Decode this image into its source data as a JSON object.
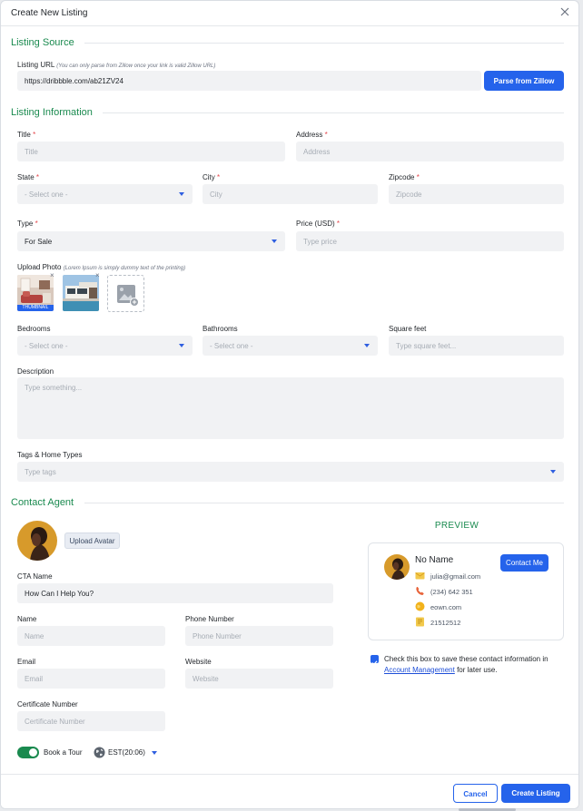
{
  "dialog": {
    "title": "Create New Listing"
  },
  "listing_source": {
    "heading": "Listing Source",
    "url_label": "Listing URL",
    "url_hint": "(You can only parse from Zillow once your link is valid Zillow URL)",
    "url_value": "https://dribbble.com/ab21ZV24",
    "parse_button": "Parse from Zillow"
  },
  "listing_info": {
    "heading": "Listing Information",
    "title_label": "Title",
    "title_placeholder": "Title",
    "address_label": "Address",
    "address_placeholder": "Address",
    "state_label": "State",
    "state_value": "- Select one -",
    "city_label": "City",
    "city_placeholder": "City",
    "zipcode_label": "Zipcode",
    "zipcode_placeholder": "Zipcode",
    "type_label": "Type",
    "type_value": "For Sale",
    "price_label": "Price (USD)",
    "price_placeholder": "Type price",
    "upload_label": "Upload Photo",
    "upload_hint": "(Lorem Ipsum is simply dummy text of the printing)",
    "thumbnail_badge": "THUMBNAIL",
    "remove_glyph": "×",
    "bedrooms_label": "Bedrooms",
    "bedrooms_value": "- Select one -",
    "bathrooms_label": "Bathrooms",
    "bathrooms_value": "- Select one -",
    "sqft_label": "Square feet",
    "sqft_placeholder": "Type square feet...",
    "description_label": "Description",
    "description_placeholder": "Type something...",
    "tags_label": "Tags & Home Types",
    "tags_placeholder": "Type tags",
    "required_mark": "*"
  },
  "contact_agent": {
    "heading": "Contact Agent",
    "upload_avatar": "Upload Avatar",
    "cta_label": "CTA Name",
    "cta_value": "How Can I Help You?",
    "name_label": "Name",
    "name_placeholder": "Name",
    "phone_label": "Phone Number",
    "phone_placeholder": "Phone Number",
    "email_label": "Email",
    "email_placeholder": "Email",
    "website_label": "Website",
    "website_placeholder": "Website",
    "cert_label": "Certificate Number",
    "cert_placeholder": "Certificate Number",
    "book_tour_label": "Book a Tour",
    "book_tour_on": true,
    "timezone": "EST(20:06)"
  },
  "preview": {
    "heading": "PREVIEW",
    "name": "No Name",
    "contact_button": "Contact Me",
    "email": "julia@gmail.com",
    "phone": "(234) 642 351",
    "website": "eown.com",
    "cert": "21512512"
  },
  "save_info": {
    "checked": true,
    "text": "Check this box to save these contact information in",
    "link": "Account Management",
    "suffix": "for later use."
  },
  "footer": {
    "cancel": "Cancel",
    "create": "Create Listing"
  },
  "colors": {
    "accent": "#2563eb",
    "section": "#1a8a4f",
    "required": "#e5484d",
    "input_bg": "#f1f2f4"
  }
}
